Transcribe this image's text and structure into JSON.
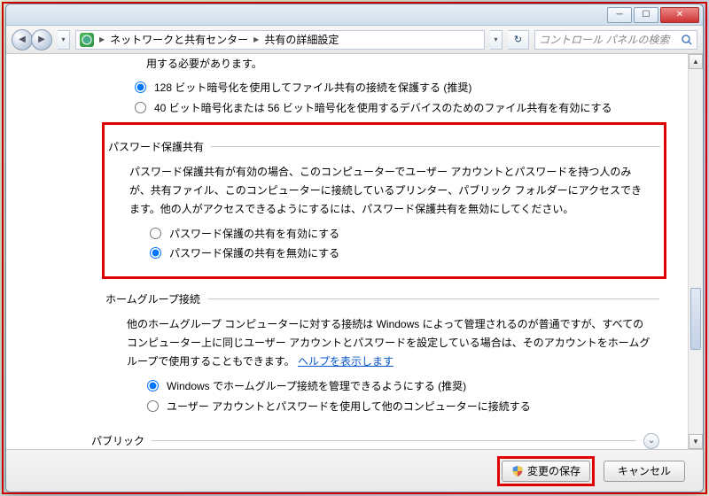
{
  "titlebar": {
    "min_label": "_",
    "max_label": "▢",
    "close_label": "×"
  },
  "nav": {
    "back_glyph": "◀",
    "fwd_glyph": "▶",
    "dd_glyph": "▾",
    "crumb1": "ネットワークと共有センター",
    "crumb2": "共有の詳細設定",
    "tri": "▶",
    "refresh_glyph": "↻",
    "search_placeholder": "コントロール パネルの検索"
  },
  "top_truncated1": "用する必要があります。",
  "encryption": {
    "opt1": "128 ビット暗号化を使用してファイル共有の接続を保護する (推奨)",
    "opt2": "40 ビット暗号化または 56 ビット暗号化を使用するデバイスのためのファイル共有を有効にする"
  },
  "password": {
    "title": "パスワード保護共有",
    "desc": "パスワード保護共有が有効の場合、このコンピューターでユーザー アカウントとパスワードを持つ人のみが、共有ファイル、このコンピューターに接続しているプリンター、パブリック フォルダーにアクセスできます。他の人がアクセスできるようにするには、パスワード保護共有を無効にしてください。",
    "opt_on": "パスワード保護の共有を有効にする",
    "opt_off": "パスワード保護の共有を無効にする"
  },
  "homegroup": {
    "title": "ホームグループ接続",
    "desc_a": "他のホームグループ コンピューターに対する接続は Windows によって管理されるのが普通ですが、すべてのコンピューター上に同じユーザー アカウントとパスワードを設定している場合は、そのアカウントをホームグループで使用することもできます。",
    "help_link": "ヘルプを表示します",
    "opt1": "Windows でホームグループ接続を管理できるようにする (推奨)",
    "opt2": "ユーザー アカウントとパスワードを使用して他のコンピューターに接続する"
  },
  "public": {
    "title": "パブリック",
    "expand_glyph": "⌄"
  },
  "footer": {
    "save": "変更の保存",
    "cancel": "キャンセル"
  },
  "scrollbar": {
    "up": "▲",
    "down": "▼"
  }
}
